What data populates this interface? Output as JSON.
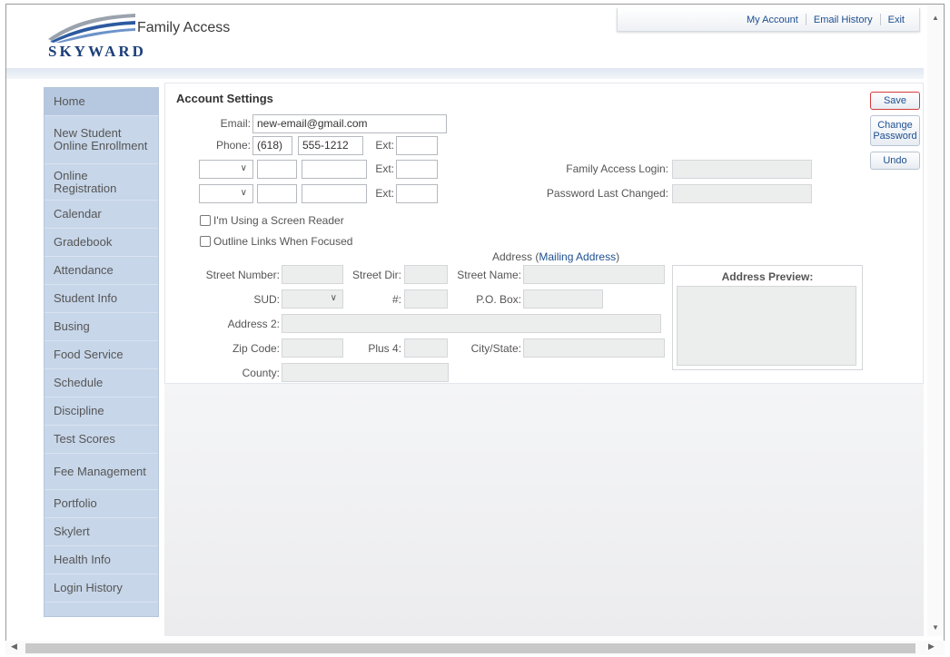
{
  "brand": {
    "logo_text": "SKYWARD",
    "app_title": "Family Access"
  },
  "top_links": {
    "my_account": "My Account",
    "email_history": "Email History",
    "exit": "Exit"
  },
  "sidebar": {
    "items": [
      {
        "label": "Home"
      },
      {
        "label": "New Student Online Enrollment"
      },
      {
        "label": "Online Registration"
      },
      {
        "label": "Calendar"
      },
      {
        "label": "Gradebook"
      },
      {
        "label": "Attendance"
      },
      {
        "label": "Student Info"
      },
      {
        "label": "Busing"
      },
      {
        "label": "Food Service"
      },
      {
        "label": "Schedule"
      },
      {
        "label": "Discipline"
      },
      {
        "label": "Test Scores"
      },
      {
        "label": "Fee Management"
      },
      {
        "label": "Portfolio"
      },
      {
        "label": "Skylert"
      },
      {
        "label": "Health Info"
      },
      {
        "label": "Login History"
      }
    ]
  },
  "account": {
    "title": "Account Settings",
    "email_label": "Email:",
    "email_value": "new-email@gmail.com",
    "phone_label": "Phone:",
    "phone_area": "(618)",
    "phone_number": "555-1212",
    "ext_label": "Ext:",
    "family_access_login_label": "Family Access Login:",
    "password_last_changed_label": "Password Last Changed:",
    "screen_reader_label": "I'm Using a Screen Reader",
    "outline_links_label": "Outline Links When Focused"
  },
  "address": {
    "header_prefix": "Address (",
    "header_link": "Mailing Address",
    "header_suffix": ")",
    "street_number_label": "Street Number:",
    "street_dir_label": "Street Dir:",
    "street_name_label": "Street Name:",
    "sud_label": "SUD:",
    "number_label": "#:",
    "po_box_label": "P.O. Box:",
    "address2_label": "Address 2:",
    "zip_label": "Zip Code:",
    "plus4_label": "Plus 4:",
    "city_state_label": "City/State:",
    "county_label": "County:",
    "preview_title": "Address Preview:"
  },
  "buttons": {
    "save": "Save",
    "change_password": "Change Password",
    "undo": "Undo"
  },
  "colors": {
    "accent_link": "#1d4f91",
    "sidebar_bg": "#c7d6e9",
    "focus_border": "#d23c3c"
  }
}
